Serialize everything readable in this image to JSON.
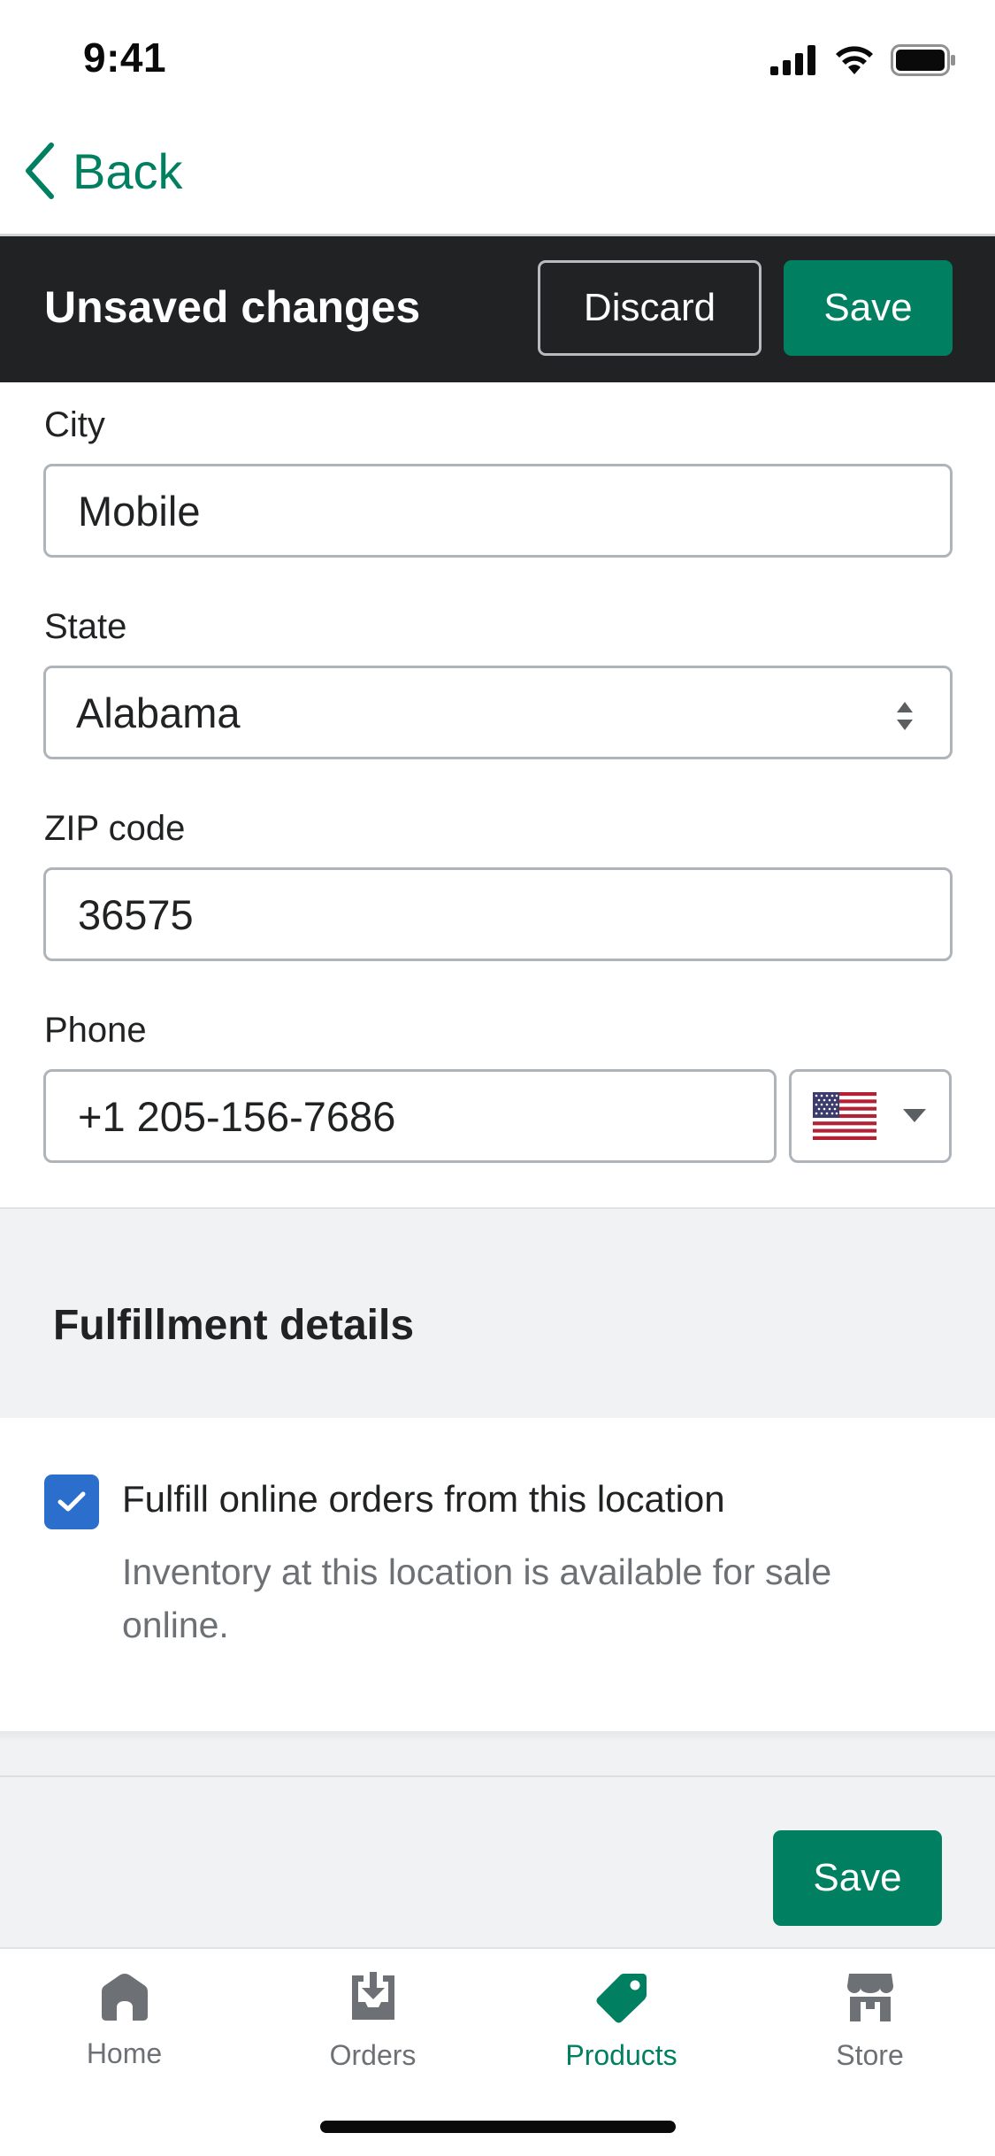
{
  "status_bar": {
    "time": "9:41",
    "icons": [
      "cellular-signal-icon",
      "wifi-icon",
      "battery-icon"
    ]
  },
  "nav": {
    "back_label": "Back",
    "back_icon": "chevron-left-icon"
  },
  "unsaved_bar": {
    "title": "Unsaved changes",
    "discard_label": "Discard",
    "save_label": "Save"
  },
  "form": {
    "city": {
      "label": "City",
      "value": "Mobile"
    },
    "state": {
      "label": "State",
      "value": "Alabama"
    },
    "zip": {
      "label": "ZIP code",
      "value": "36575"
    },
    "phone": {
      "label": "Phone",
      "value": "+1 205-156-7686",
      "country_icon": "us-flag-icon"
    }
  },
  "fulfillment": {
    "title": "Fulfillment details",
    "checkbox_checked": true,
    "checkbox_label": "Fulfill online orders from this location",
    "help_text": "Inventory at this location is available for sale online."
  },
  "footer": {
    "save_label": "Save"
  },
  "tabbar": {
    "tabs": [
      {
        "label": "Home",
        "icon": "home-icon",
        "active": false
      },
      {
        "label": "Orders",
        "icon": "orders-icon",
        "active": false
      },
      {
        "label": "Products",
        "icon": "tag-icon",
        "active": true
      },
      {
        "label": "Store",
        "icon": "store-icon",
        "active": false
      }
    ]
  },
  "colors": {
    "accent": "#008060",
    "dark_bar": "#202223",
    "checkbox": "#2c6ecb",
    "muted_text": "#6d7175"
  }
}
